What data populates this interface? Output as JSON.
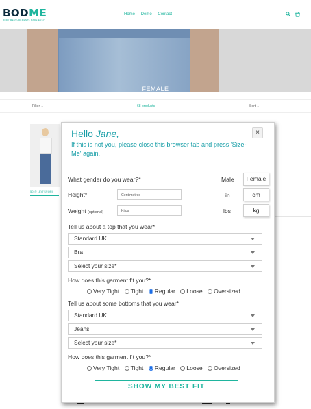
{
  "store": {
    "logo_main": "BOD",
    "logo_accent": "ME",
    "logo_tagline": "BODY MEASUREMENTS MADE EASY",
    "nav": [
      "Home",
      "Demo",
      "Contact"
    ],
    "hero_title": "FEMALE",
    "filter_label": "Filter",
    "product_count": "68 products",
    "sort_label": "Sort",
    "product_name": "501® LEVI'S®ORI"
  },
  "modal": {
    "hello": "Hello",
    "user_name": "Jane,",
    "subtitle": "If this is not you, please close this browser tab and press 'Size-Me' again.",
    "close_label": "×",
    "gender_question": "What gender do you wear?*",
    "gender_selected": "Male",
    "gender_other": "Female",
    "height_label": "Height*",
    "height_placeholder": "Centimetres",
    "height_unit_in": "in",
    "height_unit_cm": "cm",
    "weight_label": "Weight",
    "weight_optional": "(optional)",
    "weight_placeholder": "Kilos",
    "weight_unit_lbs": "lbs",
    "weight_unit_kg": "kg",
    "top_question": "Tell us about a top that you wear*",
    "top_selects": [
      "Standard UK",
      "Bra",
      "Select your size*"
    ],
    "fit_question": "How does this garment fit you?*",
    "fit_options": [
      "Very Tight",
      "Tight",
      "Regular",
      "Loose",
      "Oversized"
    ],
    "top_fit_selected": "Regular",
    "bottom_question": "Tell us about some bottoms that you wear*",
    "bottom_selects": [
      "Standard UK",
      "Jeans",
      "Select your size*"
    ],
    "bottom_fit_selected": "Regular",
    "cta_label": "SHOW MY BEST FIT"
  },
  "colors": {
    "brand_teal": "#1fb59e",
    "heading_teal": "#1a9fa8",
    "radio_blue": "#1c6ee6"
  }
}
